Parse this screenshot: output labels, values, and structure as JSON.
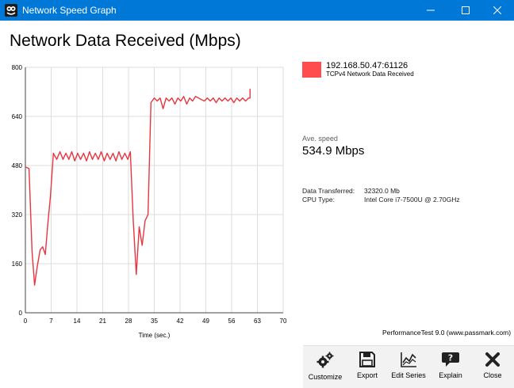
{
  "window": {
    "title": "Network Speed Graph"
  },
  "page_title": "Network Data Received (Mbps)",
  "legend": {
    "series_name": "192.168.50.47:61126",
    "series_desc": "TCPv4 Network Data Received",
    "color": "#ff4c4c"
  },
  "stats": {
    "ave_label": "Ave. speed",
    "ave_value": "534.9 Mbps",
    "data_transferred_label": "Data Transferred:",
    "data_transferred_value": "32320.0 Mb",
    "cpu_type_label": "CPU Type:",
    "cpu_type_value": "Intel Core i7-7500U @ 2.70GHz"
  },
  "credit": "PerformanceTest 9.0 (www.passmark.com)",
  "toolbar": [
    {
      "label": "Customize",
      "icon": "gears-icon"
    },
    {
      "label": "Export",
      "icon": "save-icon"
    },
    {
      "label": "Edit Series",
      "icon": "line-chart-icon"
    },
    {
      "label": "Explain",
      "icon": "help-icon"
    },
    {
      "label": "Close",
      "icon": "close-x-icon"
    }
  ],
  "chart_data": {
    "type": "line",
    "xlabel": "Time (sec.)",
    "ylabel": "",
    "xlim": [
      0,
      70
    ],
    "ylim": [
      0,
      800
    ],
    "x_ticks": [
      0,
      7,
      14,
      21,
      28,
      35,
      42,
      49,
      56,
      63,
      70
    ],
    "y_ticks": [
      0,
      160,
      320,
      480,
      640,
      800
    ],
    "grid": true,
    "series": [
      {
        "color": "#e8353f",
        "x": [
          0,
          1,
          1.8,
          2.5,
          3.2,
          4,
          4.7,
          5.4,
          6.1,
          6.8,
          7.6,
          8.5,
          9.4,
          10.2,
          11,
          11.8,
          12.6,
          13.4,
          14.2,
          15,
          15.8,
          16.6,
          17.4,
          18.2,
          19,
          19.8,
          20.6,
          21.4,
          22.2,
          23,
          23.8,
          24.6,
          25.4,
          26.2,
          27,
          27.8,
          28.5,
          29.3,
          30.1,
          30.9,
          31.7,
          32.5,
          33.3,
          34.1,
          35,
          35.8,
          36.6,
          37.4,
          38.2,
          39,
          39.8,
          40.6,
          41.4,
          42.2,
          43,
          43.8,
          44.6,
          45.4,
          46.2,
          47,
          47.8,
          48.6,
          49.4,
          50.2,
          51,
          51.8,
          52.6,
          53.4,
          54.2,
          55,
          55.8,
          56.6,
          57.4,
          58.2,
          59,
          59.8,
          60.6,
          61,
          61
        ],
        "values": [
          475,
          470,
          200,
          90,
          150,
          205,
          215,
          190,
          290,
          380,
          520,
          500,
          525,
          500,
          520,
          500,
          525,
          495,
          520,
          500,
          520,
          495,
          525,
          500,
          520,
          500,
          525,
          495,
          520,
          500,
          520,
          495,
          525,
          500,
          520,
          500,
          525,
          300,
          125,
          280,
          220,
          300,
          320,
          685,
          700,
          690,
          700,
          665,
          700,
          690,
          700,
          680,
          700,
          690,
          705,
          680,
          700,
          690,
          705,
          700,
          695,
          690,
          700,
          690,
          700,
          685,
          700,
          690,
          700,
          690,
          700,
          685,
          700,
          690,
          700,
          690,
          700,
          700,
          730
        ]
      }
    ]
  }
}
